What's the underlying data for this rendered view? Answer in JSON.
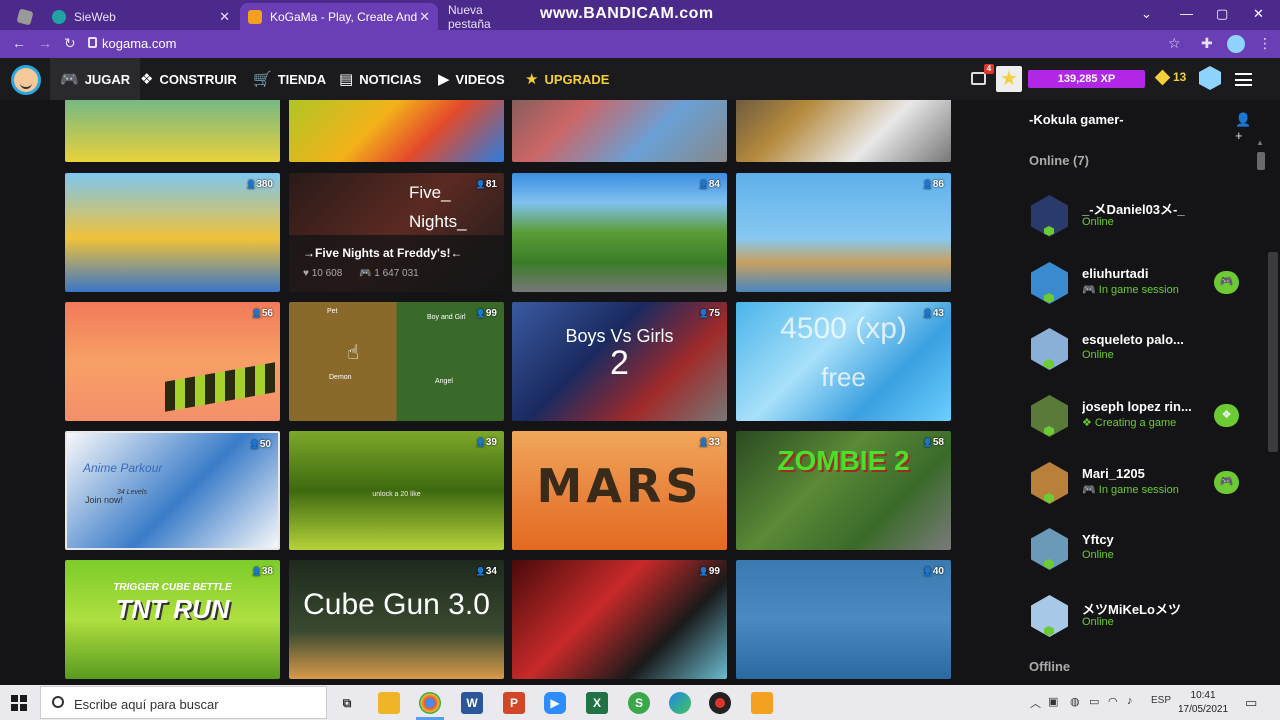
{
  "browser": {
    "tabs": [
      {
        "title": "SieWeb",
        "active": false
      },
      {
        "title": "KoGaMa - Play, Create And Share",
        "active": true
      },
      {
        "title": "Nueva pestaña",
        "active": false
      }
    ],
    "url": "kogama.com",
    "overlay_watermark": "www.BANDICAM.com"
  },
  "nav": {
    "items": [
      {
        "label": "JUGAR",
        "icon": "gamepad-icon"
      },
      {
        "label": "CONSTRUIR",
        "icon": "cubes-icon"
      },
      {
        "label": "TIENDA",
        "icon": "cart-icon"
      },
      {
        "label": "NOTICIAS",
        "icon": "newspaper-icon"
      },
      {
        "label": "VIDEOS",
        "icon": "video-icon"
      },
      {
        "label": "UPGRADE",
        "icon": "star-icon"
      }
    ],
    "notif_count": "4",
    "xp": "139,285 XP",
    "gold": "13"
  },
  "games": {
    "row0": [
      {
        "count": "",
        "bg": "linear-gradient(#0fa0c8,#e8d23a)"
      },
      {
        "count": "",
        "bg": "linear-gradient(135deg,#8ccf2c,#f3b21a 50%,#e34a2a 70%,#2a7de0)"
      },
      {
        "count": "",
        "bg": "linear-gradient(135deg,#555,#c66 40%,#6aa0d6 70%,#888)"
      },
      {
        "count": "",
        "bg": "linear-gradient(135deg,#3a3a44,#b58a3c 40%,#e8e8e8 70%,#777)"
      }
    ],
    "row1": [
      {
        "count": "380",
        "bg": "linear-gradient(#7ec6ef,#f0c23a 55%,#3a76c8)"
      },
      {
        "count": "81",
        "bg": "linear-gradient(135deg,#2a1a18,#5b2a22 50%,#1a1a1a)",
        "title_line1": "Five_",
        "title_line2": "Nights_",
        "overlay_title": "→Five Nights at Freddy's!←",
        "likes": "10 608",
        "plays": "1 647 031"
      },
      {
        "count": "84",
        "bg": "linear-gradient(#3c8de0 0%,#80c2f0 25%,#5b9c36 50%,#3a7d28 75%,#777)"
      },
      {
        "count": "86",
        "bg": "linear-gradient(#5fb0ea,#86c8f2 55%,#c8a060 75%,#4a86c0)"
      }
    ],
    "row2": [
      {
        "count": "56",
        "bg": "linear-gradient(#f27a5a,#f7a066 50%,#f48f6a)"
      },
      {
        "count": "99",
        "bg": "linear-gradient(90deg,#8a6a2a 50%,#3a6a2a 50%)",
        "labels": [
          "Pet",
          "Boy and Girl",
          "Demon",
          "Angel"
        ]
      },
      {
        "count": "75",
        "bg": "linear-gradient(135deg,#3a5aa0,#1a2a60 40%,#a02a2a 70%,#777)",
        "title": "Boys Vs Girls",
        "subtitle": "2"
      },
      {
        "count": "43",
        "bg": "linear-gradient(135deg,#4ab4ea,#a8e0fa 40%,#3aa0e0 70%,#6ccfff)",
        "title": "4500 (xp)",
        "subtitle": "free"
      }
    ],
    "row3": [
      {
        "count": "50",
        "bg": "linear-gradient(135deg,#f8f8fa,#3a7cc8 55%,#f8f8fa)",
        "title": "Anime Parkour",
        "subtitle": "34 Levels",
        "cta": "Join now!"
      },
      {
        "count": "39",
        "bg": "linear-gradient(#7ca82a,#3e6a10 50%,#b6d23a)",
        "caption": "unlock a 20 like"
      },
      {
        "count": "33",
        "bg": "linear-gradient(#f0a65a,#e8803a 60%,#e46a20)",
        "title": "MARS"
      },
      {
        "count": "58",
        "bg": "linear-gradient(135deg,#2a4a22,#5a8a36 40%,#3a6a2a 70%,#7a7a7a)",
        "title": "ZOMBIE 2"
      }
    ],
    "row4": [
      {
        "count": "38",
        "bg": "linear-gradient(#7ccc2a,#aedf40 50%,#5a9a20)",
        "title": "TNT RUN",
        "subtitle": "TRIGGER CUBE BETTLE"
      },
      {
        "count": "34",
        "bg": "linear-gradient(#1e2a1e,#3a4a30 60%,#d89a4a)",
        "title": "Cube Gun 3.0"
      },
      {
        "count": "99",
        "bg": "linear-gradient(135deg,#4a0a0a,#c82a2a 40%,#1a1a1a 70%,#6abcd0)"
      },
      {
        "count": "40",
        "bg": "linear-gradient(#3a7ab0,#4a8ac0 50%,#2a6aa0)"
      }
    ]
  },
  "sidebar": {
    "username": "-Kokula gamer-",
    "online_header": "Online (7)",
    "offline_header": "Offline",
    "friends": [
      {
        "name": "_-メDaniel03メ-_",
        "status": "Online",
        "game": false,
        "color": "#2a3a6a"
      },
      {
        "name": "eliuhurtadi",
        "status": "In game session",
        "game": true,
        "color": "#3a8ad0"
      },
      {
        "name": "esqueleto palo...",
        "status": "Online",
        "game": false,
        "color": "#8ab0d8"
      },
      {
        "name": "joseph lopez rin...",
        "status": "Creating a game",
        "game": true,
        "color": "#5a7a3a"
      },
      {
        "name": "Mari_1205",
        "status": "In game session",
        "game": true,
        "color": "#b8803a"
      },
      {
        "name": "Yftcy",
        "status": "Online",
        "game": false,
        "color": "#6a9ab8"
      },
      {
        "name": "メツMiKeLoメツ",
        "status": "Online",
        "game": false,
        "color": "#a8c8e8"
      }
    ]
  },
  "taskbar": {
    "search_placeholder": "Escribe aquí para buscar",
    "lang": "ESP",
    "time": "10:41",
    "date": "17/05/2021"
  }
}
